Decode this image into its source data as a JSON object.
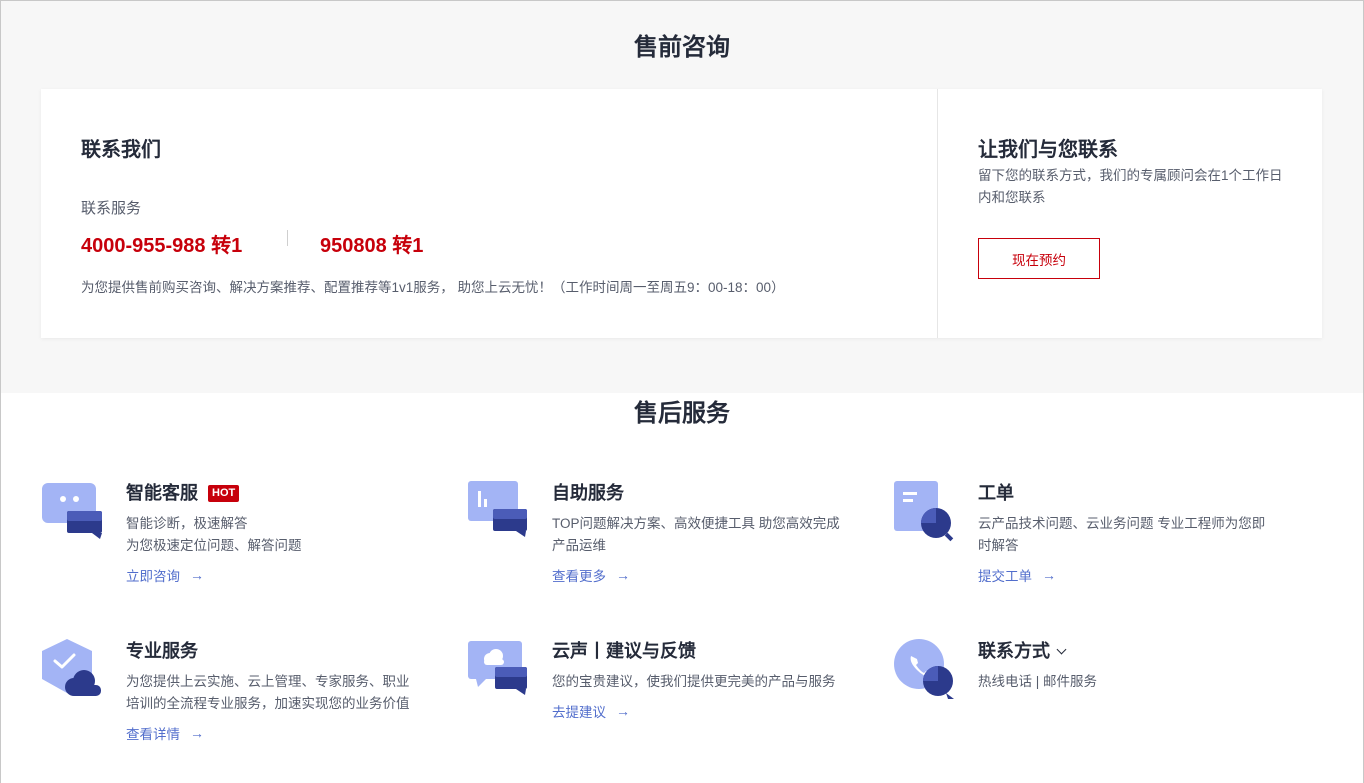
{
  "presales": {
    "title": "售前咨询",
    "contact": {
      "title": "联系我们",
      "service_label": "联系服务",
      "phone_primary": "4000-955-988 转1",
      "phone_secondary": "950808 转1",
      "description": "为您提供售前购买咨询、解决方案推荐、配置推荐等1v1服务， 助您上云无忧！（工作时间周一至周五9：00-18：00）"
    },
    "callback": {
      "title": "让我们与您联系",
      "description": "留下您的联系方式，我们的专属顾问会在1个工作日内和您联系",
      "button_label": "现在预约"
    }
  },
  "aftersales": {
    "title": "售后服务",
    "items": [
      {
        "title": "智能客服",
        "badge": "HOT",
        "desc": "智能诊断，极速解答\n为您极速定位问题、解答问题",
        "link": "立即咨询",
        "icon": "chatbot-icon"
      },
      {
        "title": "自助服务",
        "badge": "",
        "desc": "TOP问题解决方案、高效便捷工具 助您高效完成产品运维",
        "link": "查看更多",
        "icon": "self-service-chat-icon"
      },
      {
        "title": "工单",
        "badge": "",
        "desc": "云产品技术问题、云业务问题 专业工程师为您即时解答",
        "link": "提交工单",
        "icon": "ticket-search-icon"
      },
      {
        "title": "专业服务",
        "badge": "",
        "desc": "为您提供上云实施、云上管理、专家服务、职业培训的全流程专业服务，加速实现您的业务价值",
        "link": "查看详情",
        "icon": "shield-check-icon"
      },
      {
        "title": "云声丨建议与反馈",
        "badge": "",
        "desc": "您的宝贵建议，使我们提供更完美的产品与服务",
        "link": "去提建议",
        "icon": "cloud-feedback-icon"
      },
      {
        "title": "联系方式",
        "badge": "",
        "desc": "热线电话 | 邮件服务",
        "link": "",
        "icon": "phone-bubble-icon"
      }
    ],
    "link_arrow": "→"
  },
  "colors": {
    "brand_red": "#c7000b",
    "link_blue": "#526ecc",
    "icon_light": "#a3b4f5",
    "icon_dark": "#2c3a8c",
    "title_text": "#252b3a",
    "body_text": "#575d6c"
  }
}
